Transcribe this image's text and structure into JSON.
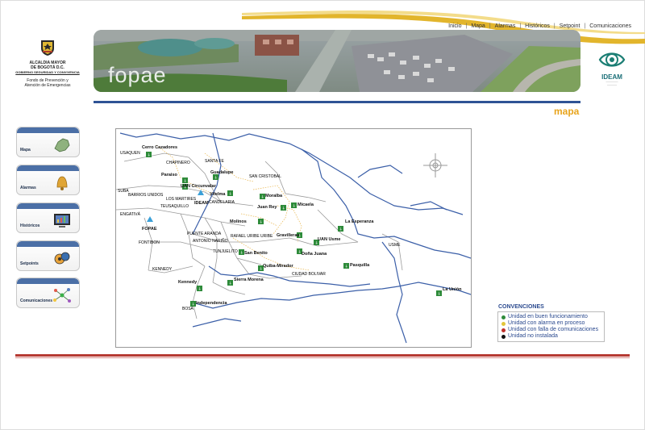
{
  "nav": {
    "items": [
      "Inicio",
      "Mapa",
      "Alarmas",
      "Históricos",
      "Setpoint",
      "Comunicaciones"
    ]
  },
  "logo_bogota": {
    "line1": "ALCALDIA MAYOR",
    "line2": "DE BOGOTÁ D.C.",
    "line3": "GOBIERNO SEGURIDAD Y CONVIVENCIA",
    "line4": "Fondo de Prevención y",
    "line5": "Atención de Emergencias"
  },
  "logo_ideam": {
    "name": "IDEAM"
  },
  "banner": {
    "title": "fopae"
  },
  "section": {
    "title": "mapa"
  },
  "sidebar": {
    "items": [
      {
        "label": "Mapa",
        "icon": "map-icon"
      },
      {
        "label": "Alarmas",
        "icon": "bell-icon"
      },
      {
        "label": "Históricos",
        "icon": "monitor-icon"
      },
      {
        "label": "Setpoints",
        "icon": "setpoint-icon"
      },
      {
        "label": "Comunicaciones",
        "icon": "network-icon"
      }
    ]
  },
  "map": {
    "places": [
      "USAQUEN",
      "CHAPINERO",
      "SANTA FE",
      "SAN CRISTOBAL",
      "SUBA",
      "BARRIOS UNIDOS",
      "LOS MARTIRES",
      "TEUSAQUILLO",
      "CANDELARIA",
      "ENGATIVÁ",
      "FONTIBON",
      "PUENTE ARANDA",
      "ANTONIO NARIÑO",
      "RAFAEL URIBE URIBE",
      "TUNJUELITO",
      "KENNEDY",
      "CIUDAD BOLIVAR",
      "USME",
      "BOSA"
    ],
    "stations": [
      "Cerro Cazadores",
      "Paraiso",
      "Guadalupe",
      "UAN Circunvalar",
      "Vitelma",
      "Moralba",
      "Juan Rey",
      "Micaela",
      "Molinos",
      "La Esperanza",
      "Gravilleras",
      "UAN Usme",
      "San Benito",
      "Doña Juana",
      "Quiba-Mirador",
      "Pasquilla",
      "Kennedy",
      "Sierra Morena",
      "Independencia",
      "La Unión"
    ],
    "hq": [
      "IDEAM",
      "FOPAE"
    ]
  },
  "legend": {
    "title": "CONVENCIONES",
    "items": [
      {
        "label": "Unidad en buen funcionamiento",
        "color": "#2e8b3a"
      },
      {
        "label": "Unidad con alarma en proceso",
        "color": "#e2c63a"
      },
      {
        "label": "Unidad con falla de comunicaciones",
        "color": "#c0312b"
      },
      {
        "label": "Unidad no instalada",
        "color": "#111111"
      }
    ]
  }
}
